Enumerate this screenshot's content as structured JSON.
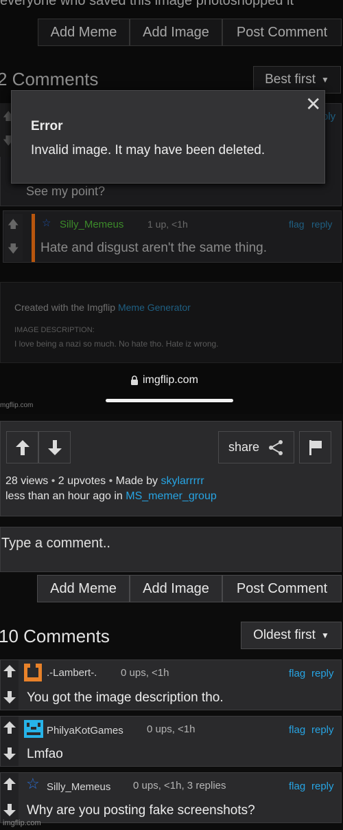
{
  "top": {
    "cut_text": "everyone who saved this image photoshopped it",
    "buttons": [
      "Add Meme",
      "Add Image",
      "Post Comment"
    ],
    "comments_count_label": "2 Comments",
    "sort_label": "Best first",
    "behind_reply": "ply"
  },
  "error_modal": {
    "title": "Error",
    "message": "Invalid image. It may have been deleted."
  },
  "faded_comment_1": {
    "text": "See my point?"
  },
  "faded_comment_2": {
    "user": "Silly_Memeus",
    "meta": "1 up, <1h",
    "flag": "flag",
    "reply": "reply",
    "text": "Hate and disgust aren't the same thing."
  },
  "created_with": {
    "prefix": "Created with the Imgflip",
    "link": "Meme Generator",
    "desc_label": "IMAGE DESCRIPTION:",
    "desc_text": "I love being a nazi so much. No hate tho. Hate iz wrong."
  },
  "browser": {
    "domain": "imgflip.com",
    "watermark": "mgflip.com"
  },
  "post": {
    "share_label": "share",
    "views": "28 views",
    "upvotes": "2 upvotes",
    "made_by_prefix": "Made by",
    "author": "skylarrrrr",
    "time_prefix": "less than an hour ago in",
    "group": "MS_memer_group"
  },
  "comment_input": {
    "placeholder": "Type a comment.."
  },
  "bottom_buttons": [
    "Add Meme",
    "Add Image",
    "Post Comment"
  ],
  "comments_header": {
    "count_label": "10 Comments",
    "sort_label": "Oldest first"
  },
  "comments": [
    {
      "user": ".-Lambert-.",
      "meta": "0 ups, <1h",
      "text": "You got the image description tho.",
      "flag": "flag",
      "reply": "reply",
      "avatar_color": "#e8822a"
    },
    {
      "user": "PhilyaKotGames",
      "meta": "0 ups, <1h",
      "text": "Lmfao",
      "flag": "flag",
      "reply": "reply",
      "avatar_color": "#27b3e8"
    },
    {
      "user": "Silly_Memeus",
      "meta": "0 ups, <1h, 3 replies",
      "text": "Why are you posting fake screenshots?",
      "flag": "flag",
      "reply": "reply",
      "avatar_color": "#2a6fd6"
    }
  ],
  "footer_watermark": "imgflip.com",
  "colors": {
    "link": "#27a4e3",
    "accent_orange": "#b8560e",
    "green_user": "#3c8a2a"
  }
}
